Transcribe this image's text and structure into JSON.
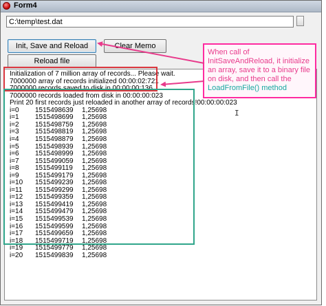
{
  "window": {
    "title": "Form4"
  },
  "path_input": {
    "value": "C:\\temp\\test.dat"
  },
  "buttons": {
    "init_save_reload": "Init, Save and Reload",
    "clear_memo": "Clear Memo",
    "reload_file": "Reload file"
  },
  "memo": {
    "header_lines": [
      "Initialization of 7 million array of records... Please wait.",
      "7000000 array of records initialized 00:00:02:721",
      "7000000 records saved to disk in 00:00:00:136",
      "7000000 records loaded from disk in 00:00:00:023",
      "Print 20 first records just reloaded in another array of records!00:00:00:023"
    ],
    "rows": [
      {
        "i": "i=0",
        "val": "1515498639",
        "dbl": "1,25698"
      },
      {
        "i": "i=1",
        "val": "1515498699",
        "dbl": "1,25698"
      },
      {
        "i": "i=2",
        "val": "1515498759",
        "dbl": "1,25698"
      },
      {
        "i": "i=3",
        "val": "1515498819",
        "dbl": "1,25698"
      },
      {
        "i": "i=4",
        "val": "1515498879",
        "dbl": "1,25698"
      },
      {
        "i": "i=5",
        "val": "1515498939",
        "dbl": "1,25698"
      },
      {
        "i": "i=6",
        "val": "1515498999",
        "dbl": "1,25698"
      },
      {
        "i": "i=7",
        "val": "1515499059",
        "dbl": "1,25698"
      },
      {
        "i": "i=8",
        "val": "1515499119",
        "dbl": "1,25698"
      },
      {
        "i": "i=9",
        "val": "1515499179",
        "dbl": "1,25698"
      },
      {
        "i": "i=10",
        "val": "1515499239",
        "dbl": "1,25698"
      },
      {
        "i": "i=11",
        "val": "1515499299",
        "dbl": "1,25698"
      },
      {
        "i": "i=12",
        "val": "1515499359",
        "dbl": "1,25698"
      },
      {
        "i": "i=13",
        "val": "1515499419",
        "dbl": "1,25698"
      },
      {
        "i": "i=14",
        "val": "1515499479",
        "dbl": "1,25698"
      },
      {
        "i": "i=15",
        "val": "1515499539",
        "dbl": "1,25698"
      },
      {
        "i": "i=16",
        "val": "1515499599",
        "dbl": "1,25698"
      },
      {
        "i": "i=17",
        "val": "1515499659",
        "dbl": "1,25698"
      },
      {
        "i": "i=18",
        "val": "1515499719",
        "dbl": "1,25698"
      },
      {
        "i": "i=19",
        "val": "1515499779",
        "dbl": "1,25698"
      },
      {
        "i": "i=20",
        "val": "1515499839",
        "dbl": "1,25698"
      }
    ]
  },
  "annotation": {
    "part1": "When call of InitSaveAndReload, it initialize an array, save it to a binary file on disk, and then call the ",
    "part2": "LoadFromFile() method"
  },
  "colors": {
    "callout_text": "#e83a8b",
    "callout_accent": "#19a8a0",
    "box_red": "#d9363e",
    "box_green": "#2fa58a",
    "arrow": "#e83a8b"
  },
  "icons": {
    "app": "app-icon",
    "cursor": "text-cursor-icon"
  }
}
